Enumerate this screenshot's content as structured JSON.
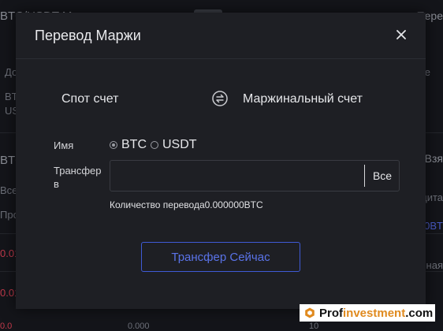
{
  "background": {
    "top_left": "BTC/USDT М",
    "top_right": "Пере",
    "left_labels": [
      "До",
      "BT",
      "US"
    ],
    "right_label_e": "е",
    "section_left": "BTC",
    "row_labels": [
      "Всег",
      "Про"
    ],
    "red_values": [
      "0.01",
      "0.01"
    ],
    "right_col": [
      "Взя",
      "дита",
      "00BT",
      "ная"
    ],
    "bottom_values": [
      "0.000",
      "10",
      "0.0"
    ]
  },
  "modal": {
    "title": "Перевод Маржи",
    "from_account": "Спот счет",
    "to_account": "Маржинальный счет",
    "name_label": "Имя",
    "currency_options": [
      {
        "label": "BTC",
        "selected": true
      },
      {
        "label": "USDT",
        "selected": false
      }
    ],
    "transfer_label": "Трансфер в",
    "amount_value": "",
    "amount_placeholder": "",
    "all_label": "Все",
    "amount_hint": "Количество перевода0.000000BTC",
    "submit_label": "Трансфер Сейчас"
  },
  "watermark": {
    "prefix": "Prof",
    "highlight": "investment",
    "suffix": ".com"
  },
  "colors": {
    "accent": "#3f5ad6",
    "modal_bg": "#1e1f24",
    "page_bg": "#14151a",
    "negative": "#c0394a",
    "watermark_orange": "#e08a1e"
  },
  "icons": {
    "close": "close-icon",
    "swap": "swap-arrows-icon",
    "watermark_logo": "hexagon-logo-icon"
  }
}
